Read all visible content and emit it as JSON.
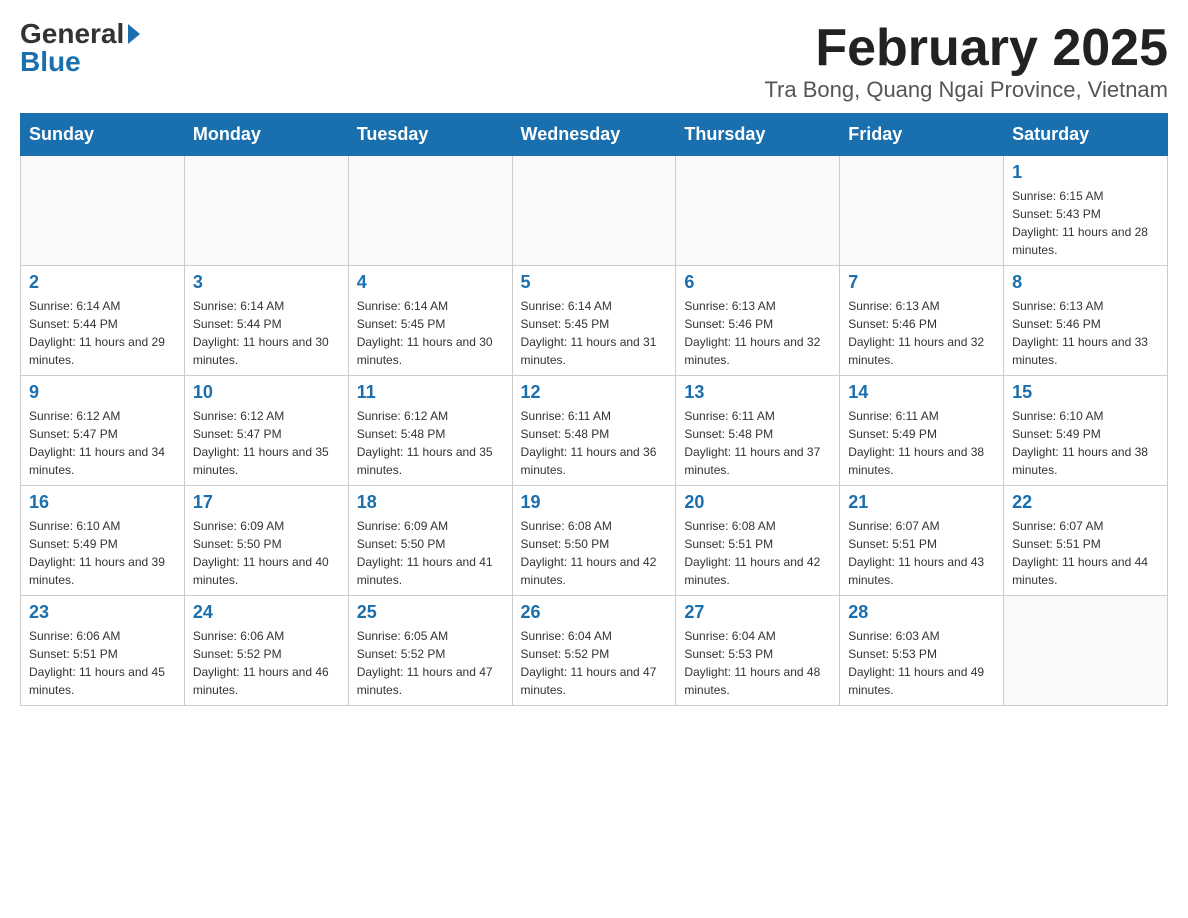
{
  "logo": {
    "general": "General",
    "blue": "Blue"
  },
  "title": "February 2025",
  "subtitle": "Tra Bong, Quang Ngai Province, Vietnam",
  "days_of_week": [
    "Sunday",
    "Monday",
    "Tuesday",
    "Wednesday",
    "Thursday",
    "Friday",
    "Saturday"
  ],
  "weeks": [
    [
      {
        "day": "",
        "info": ""
      },
      {
        "day": "",
        "info": ""
      },
      {
        "day": "",
        "info": ""
      },
      {
        "day": "",
        "info": ""
      },
      {
        "day": "",
        "info": ""
      },
      {
        "day": "",
        "info": ""
      },
      {
        "day": "1",
        "info": "Sunrise: 6:15 AM\nSunset: 5:43 PM\nDaylight: 11 hours and 28 minutes."
      }
    ],
    [
      {
        "day": "2",
        "info": "Sunrise: 6:14 AM\nSunset: 5:44 PM\nDaylight: 11 hours and 29 minutes."
      },
      {
        "day": "3",
        "info": "Sunrise: 6:14 AM\nSunset: 5:44 PM\nDaylight: 11 hours and 30 minutes."
      },
      {
        "day": "4",
        "info": "Sunrise: 6:14 AM\nSunset: 5:45 PM\nDaylight: 11 hours and 30 minutes."
      },
      {
        "day": "5",
        "info": "Sunrise: 6:14 AM\nSunset: 5:45 PM\nDaylight: 11 hours and 31 minutes."
      },
      {
        "day": "6",
        "info": "Sunrise: 6:13 AM\nSunset: 5:46 PM\nDaylight: 11 hours and 32 minutes."
      },
      {
        "day": "7",
        "info": "Sunrise: 6:13 AM\nSunset: 5:46 PM\nDaylight: 11 hours and 32 minutes."
      },
      {
        "day": "8",
        "info": "Sunrise: 6:13 AM\nSunset: 5:46 PM\nDaylight: 11 hours and 33 minutes."
      }
    ],
    [
      {
        "day": "9",
        "info": "Sunrise: 6:12 AM\nSunset: 5:47 PM\nDaylight: 11 hours and 34 minutes."
      },
      {
        "day": "10",
        "info": "Sunrise: 6:12 AM\nSunset: 5:47 PM\nDaylight: 11 hours and 35 minutes."
      },
      {
        "day": "11",
        "info": "Sunrise: 6:12 AM\nSunset: 5:48 PM\nDaylight: 11 hours and 35 minutes."
      },
      {
        "day": "12",
        "info": "Sunrise: 6:11 AM\nSunset: 5:48 PM\nDaylight: 11 hours and 36 minutes."
      },
      {
        "day": "13",
        "info": "Sunrise: 6:11 AM\nSunset: 5:48 PM\nDaylight: 11 hours and 37 minutes."
      },
      {
        "day": "14",
        "info": "Sunrise: 6:11 AM\nSunset: 5:49 PM\nDaylight: 11 hours and 38 minutes."
      },
      {
        "day": "15",
        "info": "Sunrise: 6:10 AM\nSunset: 5:49 PM\nDaylight: 11 hours and 38 minutes."
      }
    ],
    [
      {
        "day": "16",
        "info": "Sunrise: 6:10 AM\nSunset: 5:49 PM\nDaylight: 11 hours and 39 minutes."
      },
      {
        "day": "17",
        "info": "Sunrise: 6:09 AM\nSunset: 5:50 PM\nDaylight: 11 hours and 40 minutes."
      },
      {
        "day": "18",
        "info": "Sunrise: 6:09 AM\nSunset: 5:50 PM\nDaylight: 11 hours and 41 minutes."
      },
      {
        "day": "19",
        "info": "Sunrise: 6:08 AM\nSunset: 5:50 PM\nDaylight: 11 hours and 42 minutes."
      },
      {
        "day": "20",
        "info": "Sunrise: 6:08 AM\nSunset: 5:51 PM\nDaylight: 11 hours and 42 minutes."
      },
      {
        "day": "21",
        "info": "Sunrise: 6:07 AM\nSunset: 5:51 PM\nDaylight: 11 hours and 43 minutes."
      },
      {
        "day": "22",
        "info": "Sunrise: 6:07 AM\nSunset: 5:51 PM\nDaylight: 11 hours and 44 minutes."
      }
    ],
    [
      {
        "day": "23",
        "info": "Sunrise: 6:06 AM\nSunset: 5:51 PM\nDaylight: 11 hours and 45 minutes."
      },
      {
        "day": "24",
        "info": "Sunrise: 6:06 AM\nSunset: 5:52 PM\nDaylight: 11 hours and 46 minutes."
      },
      {
        "day": "25",
        "info": "Sunrise: 6:05 AM\nSunset: 5:52 PM\nDaylight: 11 hours and 47 minutes."
      },
      {
        "day": "26",
        "info": "Sunrise: 6:04 AM\nSunset: 5:52 PM\nDaylight: 11 hours and 47 minutes."
      },
      {
        "day": "27",
        "info": "Sunrise: 6:04 AM\nSunset: 5:53 PM\nDaylight: 11 hours and 48 minutes."
      },
      {
        "day": "28",
        "info": "Sunrise: 6:03 AM\nSunset: 5:53 PM\nDaylight: 11 hours and 49 minutes."
      },
      {
        "day": "",
        "info": ""
      }
    ]
  ]
}
